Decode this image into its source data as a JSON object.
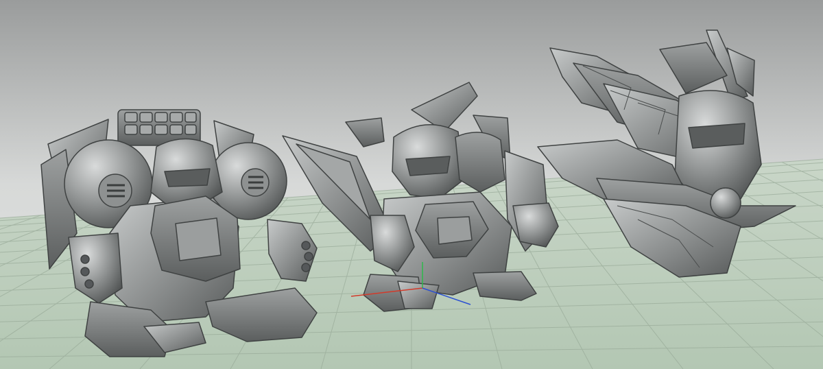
{
  "viewport": {
    "background_top": "#9a9c9c",
    "background_mid": "#d7d9d8",
    "floor_color": "#b9cbb9",
    "grid_line_color": "#8fa08f"
  },
  "gizmo": {
    "x_axis_color": "#d23a2a",
    "y_axis_color": "#2db84a",
    "z_axis_color": "#2a4fd2"
  },
  "models": [
    {
      "name": "round-shouldered-robot-model",
      "surface_color": "#7f8282"
    },
    {
      "name": "winged-knight-robot-model",
      "surface_color": "#7d8080"
    },
    {
      "name": "winged-bust-robot-model",
      "surface_color": "#818484"
    }
  ]
}
